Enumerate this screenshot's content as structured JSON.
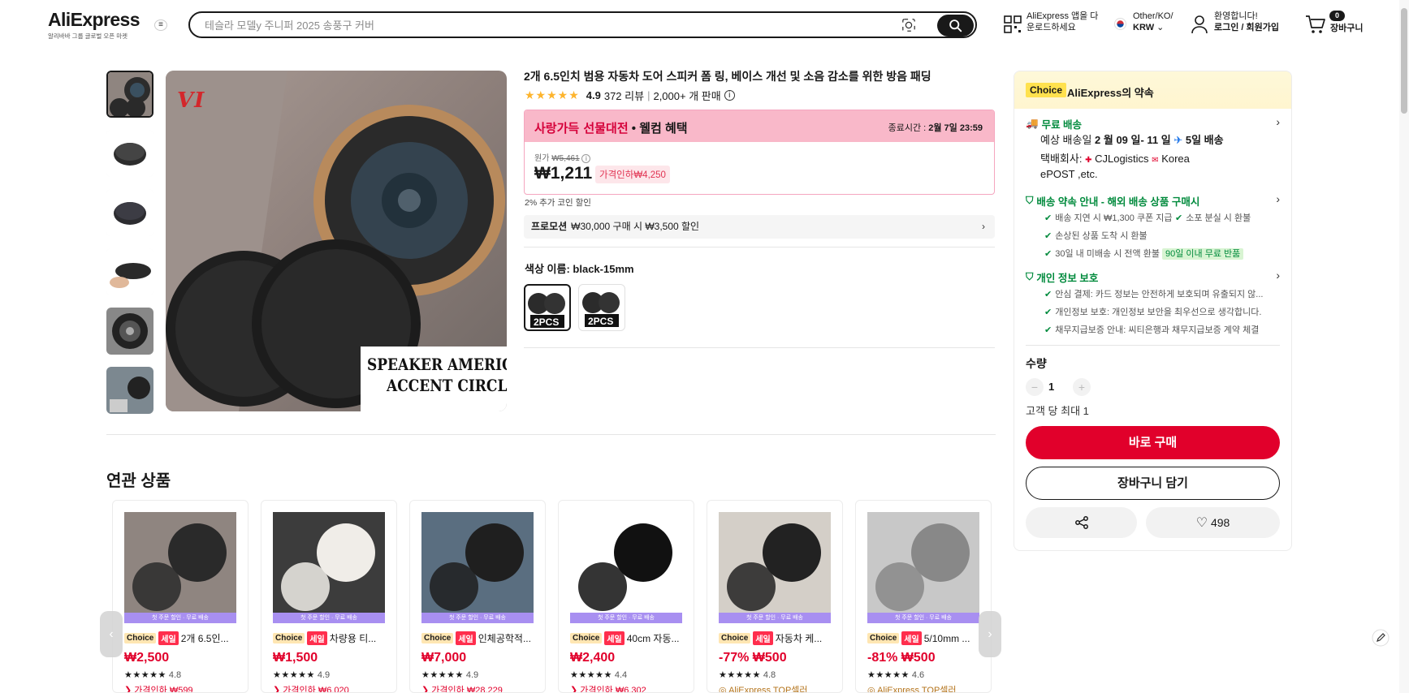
{
  "header": {
    "logo": "AliExpress",
    "logo_sub": "알리바바 그룹 글로벌 오픈 마켓",
    "search_placeholder": "테슬라 모델y 주니퍼 2025 송풍구 커버",
    "app_line1": "AliExpress 앱을 다",
    "app_line2": "운로드하세요",
    "region_line1": "Other/KO/",
    "region_line2": "KRW",
    "login_line1": "환영합니다!",
    "login_line2": "로그인 / 회원가입",
    "cart_count": "0",
    "cart_label": "장바구니"
  },
  "product": {
    "title": "2개 6.5인치 범용 자동차 도어 스피커 폼 링, 베이스 개선 및 소음 감소를 위한 방음 패딩",
    "rating": "4.9",
    "reviews": "372 리뷰",
    "sold": "2,000+ 개 판매",
    "promo_label_a": "사랑가득 선물대전",
    "promo_label_b": " • 웰컴 혜택",
    "end_label": "종료시간 :",
    "end_time": "2월 7일 23:59",
    "orig_label": "원가",
    "orig_price": "₩5,461",
    "price": "₩1,211",
    "discount": "가격인하₩4,250",
    "coin": "2% 추가 코인 할인",
    "promotion_label": "프로모션",
    "promotion_text": "₩30,000 구매 시 ₩3,500 할인",
    "color_label": "색상 이름:",
    "color_value": "black-15mm",
    "image_text_1": "SPEAKER AMERICAN",
    "image_text_2": "ACCENT CIRCLE",
    "swatch_text": "2PCS"
  },
  "related": {
    "title": "연관 상품",
    "bar_text": "첫 주문 할인 · 무료 배송",
    "choice": "Choice",
    "sale": "세일",
    "items": [
      {
        "name": "2개 6.5인...",
        "price": "₩2,500",
        "rating": "4.8",
        "extra": "가격인하 ₩599",
        "extra_type": "price"
      },
      {
        "name": "차량용 티...",
        "price": "₩1,500",
        "rating": "4.9",
        "extra": "가격인하 ₩6,020",
        "extra_type": "price"
      },
      {
        "name": "인체공학적...",
        "price": "₩7,000",
        "rating": "4.9",
        "extra": "가격인하 ₩28,229",
        "extra_type": "price"
      },
      {
        "name": "40cm 자동...",
        "price": "₩2,400",
        "rating": "4.4",
        "extra": "가격인하 ₩6,302",
        "extra_type": "price"
      },
      {
        "name": "자동차 케...",
        "price": "-77% ₩500",
        "rating": "4.8",
        "extra": "AliExpress TOP셀러",
        "extra_type": "top"
      },
      {
        "name": "5/10mm ...",
        "price": "-81% ₩500",
        "rating": "4.6",
        "extra": "AliExpress TOP셀러",
        "extra_type": "top"
      }
    ]
  },
  "panel": {
    "choice": "Choice",
    "promise": "AliExpress의 약속",
    "shipping": "무료 배송",
    "delivery_a": "예상 배송일 ",
    "delivery_b": "2 월 09 일- 11 일",
    "delivery_c": " 5일 배송",
    "carrier_a": "택배회사:",
    "carrier_b": "CJLogistics",
    "carrier_c": "Korea",
    "carrier_d": "ePOST ,etc.",
    "guarantee": "배송 약속 안내 - 해외 배송 상품 구매시",
    "g1": "배송 지연 시 ₩1,300 쿠폰 지급",
    "g2": "소포 분실 시 환불",
    "g3": "손상된 상품 도착 시 환불",
    "g4": "30일 내 미배송 시 전액 환불",
    "g4_badge": "90일 이내 무료 반품",
    "privacy": "개인 정보 보호",
    "p1": "안심 결제: 카드 정보는 안전하게 보호되며 유출되지 않...",
    "p2": "개인정보 보호: 개인정보 보안을 최우선으로 생각합니다.",
    "p3": "채무지급보증 안내: 씨티은행과 채무지급보증 계약 체결",
    "qty_label": "수량",
    "qty": "1",
    "limit": "고객 당 최대 1",
    "buy": "바로 구매",
    "add_cart": "장바구니 담기",
    "wishlist": "498"
  }
}
